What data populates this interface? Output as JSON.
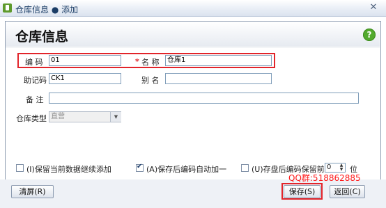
{
  "window": {
    "title": "仓库信息 ● 添加",
    "close_label": "✕"
  },
  "header": {
    "title": "仓库信息",
    "help_icon": "help-icon",
    "help_label": "?"
  },
  "form": {
    "code_label": "编 码",
    "code_value": "01",
    "required_mark": "*",
    "name_label": "名 称",
    "name_value": "仓库1",
    "mnemonic_label": "助记码",
    "mnemonic_value": "CK1",
    "alias_label": "别 名",
    "alias_value": "",
    "note_label": "备 注",
    "note_value": "",
    "type_label": "仓库类型",
    "type_value": "直营"
  },
  "options": {
    "keep_data": {
      "label": "(I)保留当前数据继续添加",
      "checked": false
    },
    "auto_increment": {
      "label": "(A)保存后编码自动加一",
      "checked": true
    },
    "keep_prefix": {
      "label": "(U)存盘后编码保留前",
      "checked": false
    },
    "prefix_count": "0",
    "prefix_unit": "位"
  },
  "watermark": "QQ群:518862885",
  "buttons": {
    "clear": "清屏(R)",
    "save": "保存(S)",
    "back": "返回(C)"
  },
  "colors": {
    "highlight": "#e2242a",
    "required": "#e2242a",
    "help": "#52aa2d",
    "watermark": "#ff1a1a"
  }
}
